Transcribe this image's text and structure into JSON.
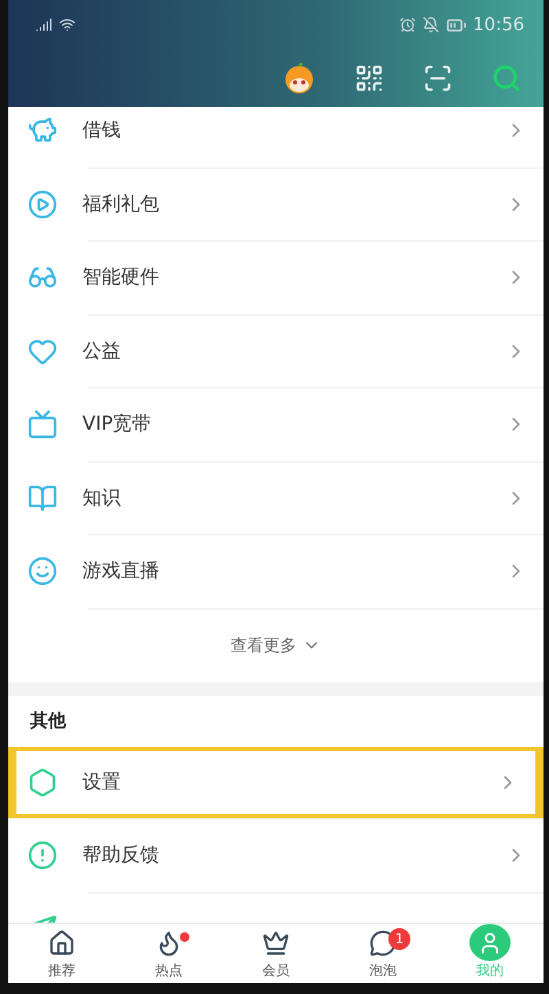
{
  "status_bar": {
    "time": "10:56"
  },
  "services": [
    {
      "label": "借钱"
    },
    {
      "label": "福利礼包"
    },
    {
      "label": "智能硬件"
    },
    {
      "label": "公益"
    },
    {
      "label": "VIP宽带"
    },
    {
      "label": "知识"
    },
    {
      "label": "游戏直播"
    }
  ],
  "show_more": "查看更多",
  "other_section": {
    "title": "其他",
    "items": [
      {
        "label": "设置",
        "highlighted": true
      },
      {
        "label": "帮助反馈",
        "highlighted": false
      }
    ]
  },
  "tabs": [
    {
      "label": "推荐",
      "selected": false,
      "dot": false
    },
    {
      "label": "热点",
      "selected": false,
      "dot": true
    },
    {
      "label": "会员",
      "selected": false,
      "dot": false
    },
    {
      "label": "泡泡",
      "selected": false,
      "dot": false,
      "badge": "1"
    },
    {
      "label": "我的",
      "selected": true,
      "dot": false
    }
  ]
}
